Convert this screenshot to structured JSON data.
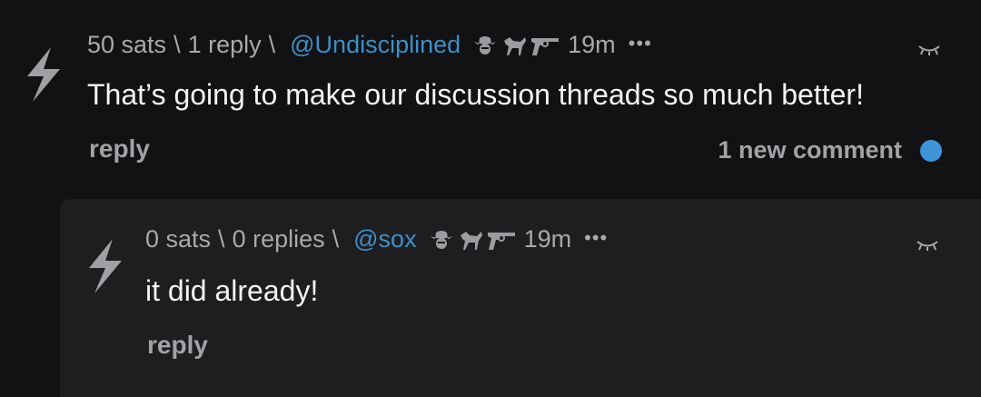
{
  "colors": {
    "background": "#121214",
    "reply_background": "#1e1e21",
    "username": "#3f8fc8",
    "meta_text": "#a9a9ad",
    "new_comment_dot": "#3d95d8"
  },
  "comments": [
    {
      "sats": "50 sats",
      "sep1": "\\",
      "replies": "1 reply",
      "sep2": "\\",
      "user": "@Undisciplined",
      "badges": [
        "cowboy-hat-icon",
        "horse-icon",
        "revolver-icon"
      ],
      "time": "19m",
      "more": "•••",
      "text": "That’s going to make our discussion threads so much better!",
      "reply_label": "reply",
      "new_comments": "1 new comment"
    },
    {
      "sats": "0 sats",
      "sep1": "\\",
      "replies": "0 replies",
      "sep2": "\\",
      "user": "@sox",
      "badges": [
        "cowboy-hat-icon",
        "horse-icon",
        "revolver-icon"
      ],
      "time": "19m",
      "more": "•••",
      "text": "it did already!",
      "reply_label": "reply"
    }
  ]
}
